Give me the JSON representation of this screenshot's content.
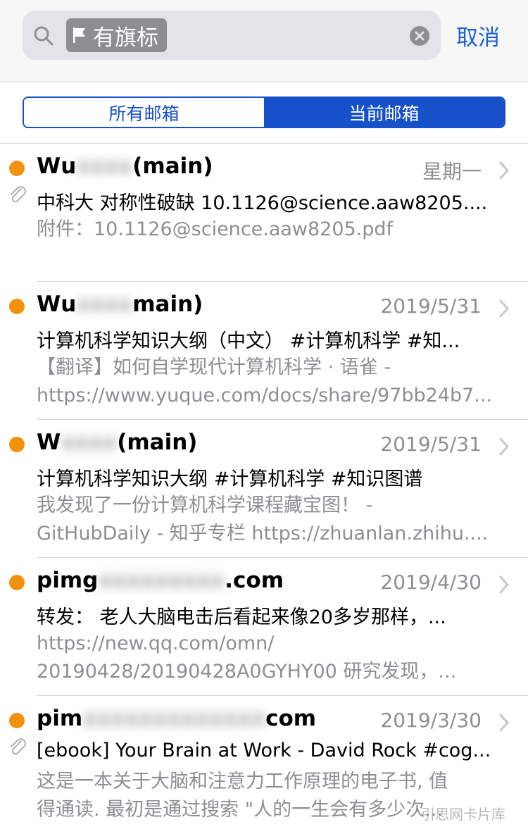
{
  "search": {
    "token_label": "有旗标",
    "cancel_label": "取消"
  },
  "segment": {
    "all_label": "所有邮箱",
    "current_label": "当前邮箱",
    "selected": "current"
  },
  "mails": [
    {
      "sender_visible_start": "Wu",
      "sender_visible_end": "(main)",
      "date": "星期一",
      "has_attachment": true,
      "subject": "中科大 对称性破缺 10.1126@science.aaw8205....",
      "preview_lines": [
        "附件：10.1126@science.aaw8205.pdf"
      ]
    },
    {
      "sender_visible_start": "Wu",
      "sender_visible_end": "main)",
      "date": "2019/5/31",
      "has_attachment": false,
      "subject": "计算机科学知识大纲（中文） #计算机科学 #知...",
      "preview_lines": [
        "【翻译】如何自学现代计算机科学 · 语雀 -",
        "https://www.yuque.com/docs/share/97bb24b7..."
      ]
    },
    {
      "sender_visible_start": "W",
      "sender_visible_end": "(main)",
      "date": "2019/5/31",
      "has_attachment": false,
      "subject": "计算机科学知识大纲 #计算机科学 #知识图谱",
      "preview_lines": [
        "我发现了一份计算机科学课程藏宝图！ -",
        "GitHubDaily - 知乎专栏 https://zhuanlan.zhihu...."
      ]
    },
    {
      "sender_visible_start": "pimg",
      "sender_visible_end": ".com",
      "date": "2019/4/30",
      "has_attachment": false,
      "subject": "转发： 老人大脑电击后看起来像20多岁那样，...",
      "preview_lines": [
        "https://new.qq.com/omn/",
        "20190428/20190428A0GYHY00 研究发现，..."
      ]
    },
    {
      "sender_visible_start": "pim",
      "sender_visible_end": "com",
      "date": "2019/3/30",
      "has_attachment": true,
      "subject": "[ebook] Your Brain at Work - David Rock #cog...",
      "preview_lines": [
        "这是一本关于大脑和注意力工作原理的电子书, 值",
        "得通读. 最初是通过搜索 \"人的一生会有多少次..."
      ]
    }
  ],
  "watermark": "引思网卡片库",
  "colors": {
    "accent": "#1651c9",
    "unread": "#f2920c",
    "secondary_text": "#8e8e93",
    "token_bg": "#8e8e92"
  }
}
